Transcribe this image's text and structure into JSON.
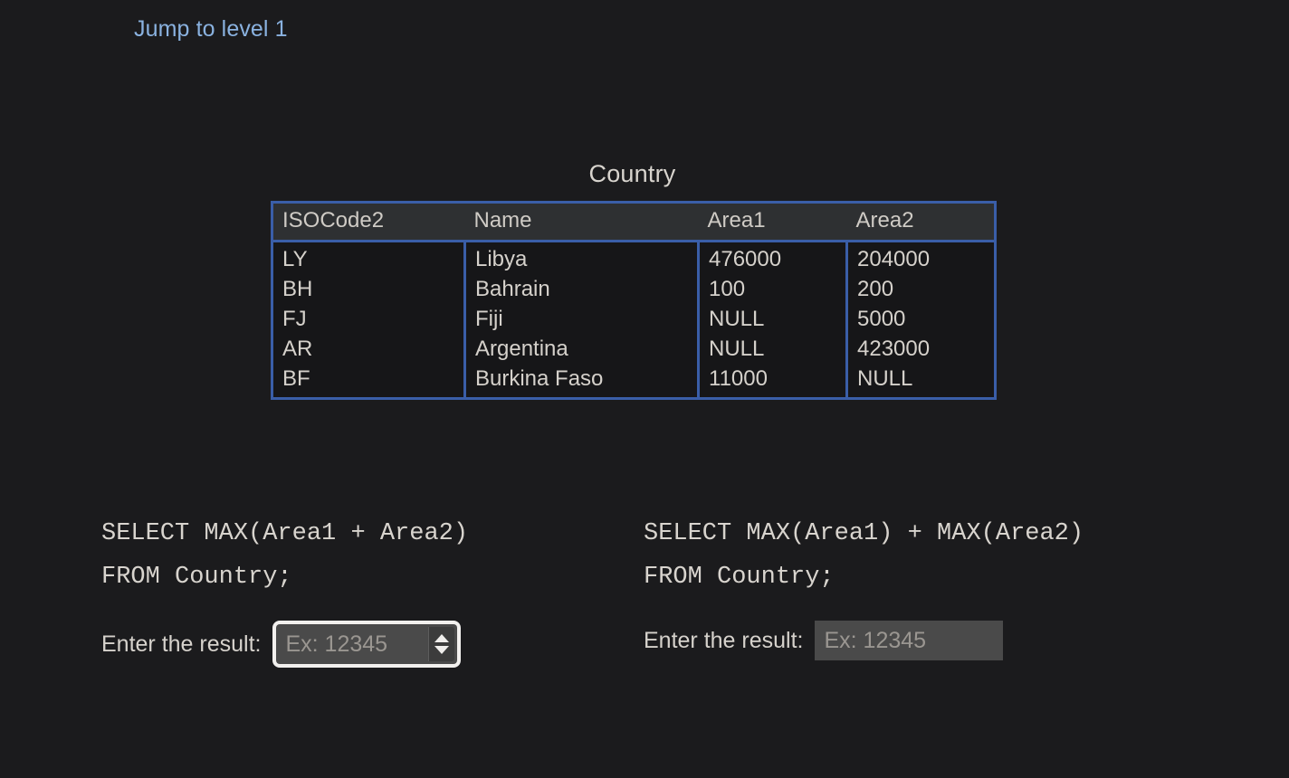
{
  "page": {
    "background_color": "#1b1b1d",
    "text_color": "#d6d2cc"
  },
  "jump_link": {
    "label": "Jump to level 1",
    "color": "#8ab2e0"
  },
  "table": {
    "caption": "Country",
    "border_color": "#3a5ea8",
    "header_background": "#2e3032",
    "columns": [
      "ISOCode2",
      "Name",
      "Area1",
      "Area2"
    ],
    "rows": [
      {
        "iso": "LY",
        "name": "Libya",
        "area1": "476000",
        "area2": "204000"
      },
      {
        "iso": "BH",
        "name": "Bahrain",
        "area1": "100",
        "area2": "200"
      },
      {
        "iso": "FJ",
        "name": "Fiji",
        "area1": "NULL",
        "area2": "5000"
      },
      {
        "iso": "AR",
        "name": "Argentina",
        "area1": "NULL",
        "area2": "423000"
      },
      {
        "iso": "BF",
        "name": "Burkina Faso",
        "area1": "11000",
        "area2": "NULL"
      }
    ]
  },
  "questions": [
    {
      "sql_line1": "SELECT MAX(Area1 + Area2)",
      "sql_line2": "FROM Country;",
      "answer_label": "Enter the result:",
      "input_value": "",
      "input_placeholder": "Ex: 12345",
      "focused": true
    },
    {
      "sql_line1": "SELECT MAX(Area1) + MAX(Area2)",
      "sql_line2": "FROM Country;",
      "answer_label": "Enter the result:",
      "input_value": "",
      "input_placeholder": "Ex: 12345",
      "focused": false
    }
  ]
}
